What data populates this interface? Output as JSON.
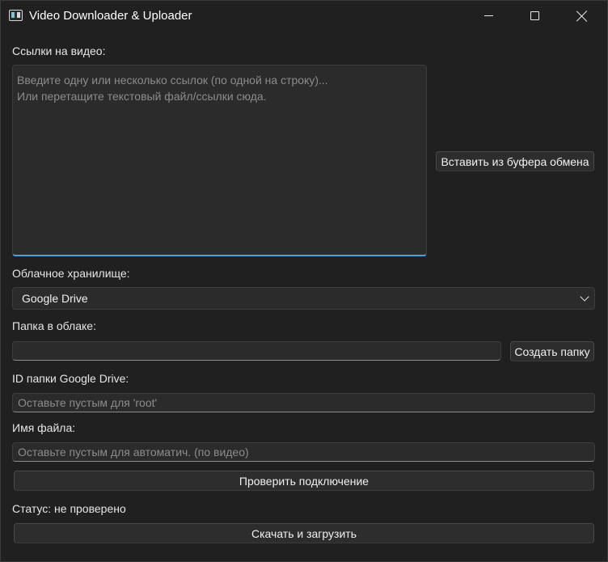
{
  "window": {
    "title": "Video Downloader & Uploader",
    "icon": "app-window-icon",
    "controls": [
      "minimize-icon",
      "maximize-icon",
      "close-icon"
    ]
  },
  "links": {
    "label": "Ссылки на видео:",
    "placeholder": "Введите одну или несколько ссылок (по одной на строку)...\nИли перетащите текстовый файл/ссылки сюда.",
    "paste_button": "Вставить из буфера обмена"
  },
  "cloud": {
    "label": "Облачное хранилище:",
    "selected": "Google Drive"
  },
  "folder": {
    "label": "Папка в облаке:",
    "value": "",
    "create_button": "Создать папку"
  },
  "folder_id": {
    "label": "ID папки Google Drive:",
    "placeholder": "Оставьте пустым для 'root'"
  },
  "filename": {
    "label": "Имя файла:",
    "placeholder": "Оставьте пустым для автоматич. (по видео)"
  },
  "check_button": "Проверить подключение",
  "status": "Статус: не проверено",
  "download_button": "Скачать и загрузить",
  "colors": {
    "background": "#202020",
    "field": "#2b2b2b",
    "focus_accent": "#4aa3df"
  }
}
